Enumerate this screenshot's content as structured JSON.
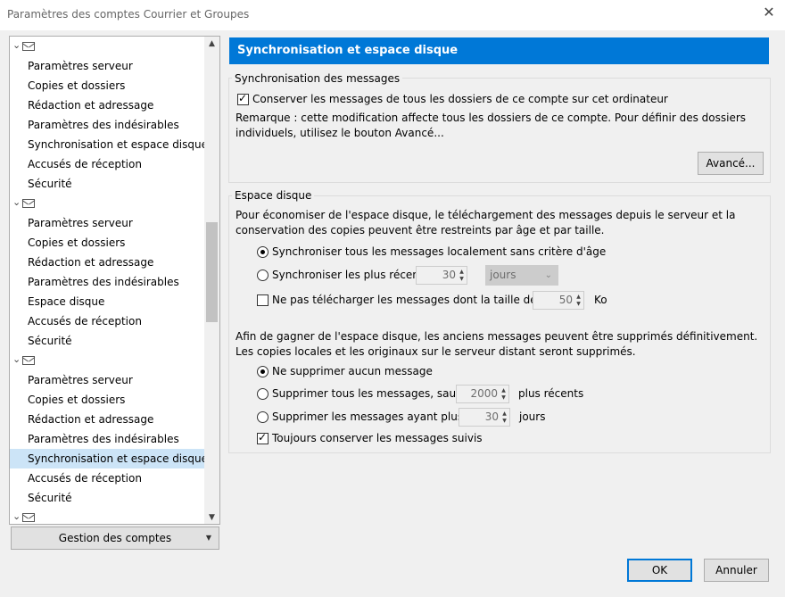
{
  "window": {
    "title": "Paramètres des comptes Courrier et Groupes"
  },
  "tree": {
    "accounts": [
      {
        "items": [
          "Paramètres serveur",
          "Copies et dossiers",
          "Rédaction et adressage",
          "Paramètres des indésirables",
          "Synchronisation et espace disque",
          "Accusés de réception",
          "Sécurité"
        ]
      },
      {
        "items": [
          "Paramètres serveur",
          "Copies et dossiers",
          "Rédaction et adressage",
          "Paramètres des indésirables",
          "Espace disque",
          "Accusés de réception",
          "Sécurité"
        ]
      },
      {
        "items": [
          "Paramètres serveur",
          "Copies et dossiers",
          "Rédaction et adressage",
          "Paramètres des indésirables",
          "Synchronisation et espace disque",
          "Accusés de réception",
          "Sécurité"
        ]
      }
    ],
    "selected": "Synchronisation et espace disque"
  },
  "manage_button": {
    "label": "Gestion des comptes"
  },
  "header": {
    "title": "Synchronisation et espace disque"
  },
  "sync": {
    "group_label": "Synchronisation des messages",
    "keep_messages_label": "Conserver les messages de tous les dossiers de ce compte sur cet ordinateur",
    "keep_messages_checked": true,
    "remark": "Remarque : cette modification affecte tous les dossiers de ce compte. Pour définir des dossiers individuels, utilisez le bouton Avancé...",
    "advanced_button": "Avancé..."
  },
  "disk": {
    "group_label": "Espace disque",
    "intro": "Pour économiser de l'espace disque, le téléchargement des messages depuis le serveur et la conservation des copies peuvent être restreints par âge et par taille.",
    "sync_all_label": "Synchroniser tous les messages localement sans critère d'âge",
    "sync_recent_label": "Synchroniser les plus récents",
    "sync_recent_value": "30",
    "sync_recent_unit": "jours",
    "no_download_label": "Ne pas télécharger les messages dont la taille dépasse",
    "no_download_value": "50",
    "no_download_unit": "Ko",
    "delete_intro": "Afin de gagner de l'espace disque, les anciens messages peuvent être supprimés définitivement. Les copies locales et les originaux sur le serveur distant seront supprimés.",
    "delete_none_label": "Ne supprimer aucun message",
    "delete_all_except_label": "Supprimer tous les messages, sauf les",
    "delete_all_except_value": "2000",
    "delete_all_except_suffix": "plus récents",
    "delete_older_label": "Supprimer les messages ayant plus de",
    "delete_older_value": "30",
    "delete_older_suffix": "jours",
    "keep_flagged_label": "Toujours conserver les messages suivis",
    "keep_flagged_checked": true
  },
  "footer": {
    "ok": "OK",
    "cancel": "Annuler"
  },
  "colors": {
    "accent": "#0078d7",
    "selection": "#cce4f7"
  }
}
